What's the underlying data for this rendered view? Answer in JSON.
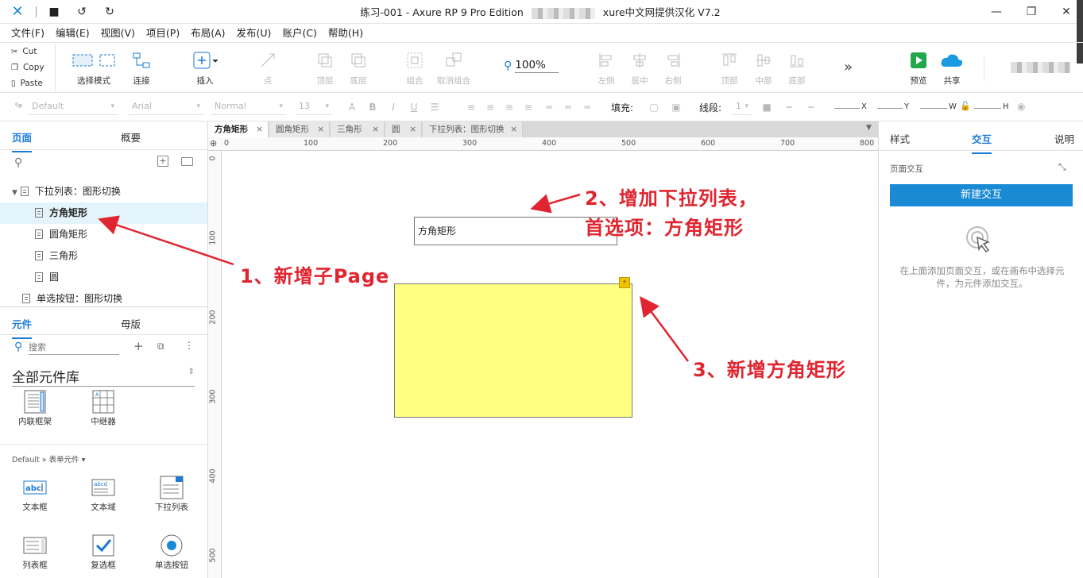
{
  "window": {
    "title_prefix": "练习-001 - Axure RP 9 Pro Edition",
    "title_suffix": "xure中文网提供汉化 V7.2"
  },
  "menu": [
    "文件(F)",
    "编辑(E)",
    "视图(V)",
    "项目(P)",
    "布局(A)",
    "发布(U)",
    "账户(C)",
    "帮助(H)"
  ],
  "clipboard": {
    "cut": "Cut",
    "copy": "Copy",
    "paste": "Paste"
  },
  "toolbar": {
    "select_mode": "选择模式",
    "connect": "连接",
    "insert": "插入",
    "point": "点",
    "top_layer": "顶层",
    "bottom_layer": "底层",
    "group": "组合",
    "ungroup": "取消组合",
    "zoom": "100%",
    "align_left": "左侧",
    "align_center": "居中",
    "align_right": "右侧",
    "align_top": "顶部",
    "align_middle": "中部",
    "align_bottom": "底部",
    "preview": "预览",
    "share": "共享"
  },
  "format": {
    "style": "Default",
    "font": "Arial",
    "weight": "Normal",
    "size": "13",
    "fill_label": "填充:",
    "stroke_label": "线段:",
    "stroke_value": "1",
    "x": "X",
    "y": "Y",
    "w": "W",
    "h": "H"
  },
  "left": {
    "tabs": {
      "pages": "页面",
      "outline": "概要"
    },
    "tree": [
      {
        "label": "下拉列表：图形切换",
        "level": 0
      },
      {
        "label": "方角矩形",
        "level": 1,
        "selected": true
      },
      {
        "label": "圆角矩形",
        "level": 1
      },
      {
        "label": "三角形",
        "level": 1
      },
      {
        "label": "圆",
        "level": 1
      },
      {
        "label": "单选按钮：图形切换",
        "level": 0
      }
    ],
    "lib_tabs": {
      "widgets": "元件",
      "masters": "母版"
    },
    "search_placeholder": "搜索",
    "library": "全部元件库",
    "widgets_top": [
      {
        "label": "内联框架"
      },
      {
        "label": "中继器"
      }
    ],
    "category": "Default » 表单元件 ▾",
    "widgets": [
      {
        "label": "文本框"
      },
      {
        "label": "文本域"
      },
      {
        "label": "下拉列表"
      },
      {
        "label": "列表框"
      },
      {
        "label": "复选框"
      },
      {
        "label": "单选按钮"
      }
    ]
  },
  "doc_tabs": [
    "方角矩形",
    "圆角矩形",
    "三角形",
    "圆",
    "下拉列表：图形切换"
  ],
  "ruler_h": [
    "0",
    "100",
    "200",
    "300",
    "400",
    "500",
    "600",
    "700",
    "800"
  ],
  "ruler_v": [
    "0",
    "100",
    "200",
    "300",
    "400",
    "500"
  ],
  "canvas": {
    "dropdown_value": "方角矩形"
  },
  "annotations": {
    "a1": "1、新增子Page",
    "a2_line1": "2、增加下拉列表，",
    "a2_line2": "首选项：方角矩形",
    "a3": "3、新增方角矩形"
  },
  "right": {
    "tabs": {
      "style": "样式",
      "interact": "交互",
      "notes": "说明"
    },
    "section": "页面交互",
    "new_button": "新建交互",
    "hint": "在上面添加页面交互，或在画布中选择元件，为元件添加交互。"
  },
  "colors": {
    "accent": "#1a8ad4",
    "annotation": "#e02530",
    "rect_fill": "#ffff80"
  }
}
